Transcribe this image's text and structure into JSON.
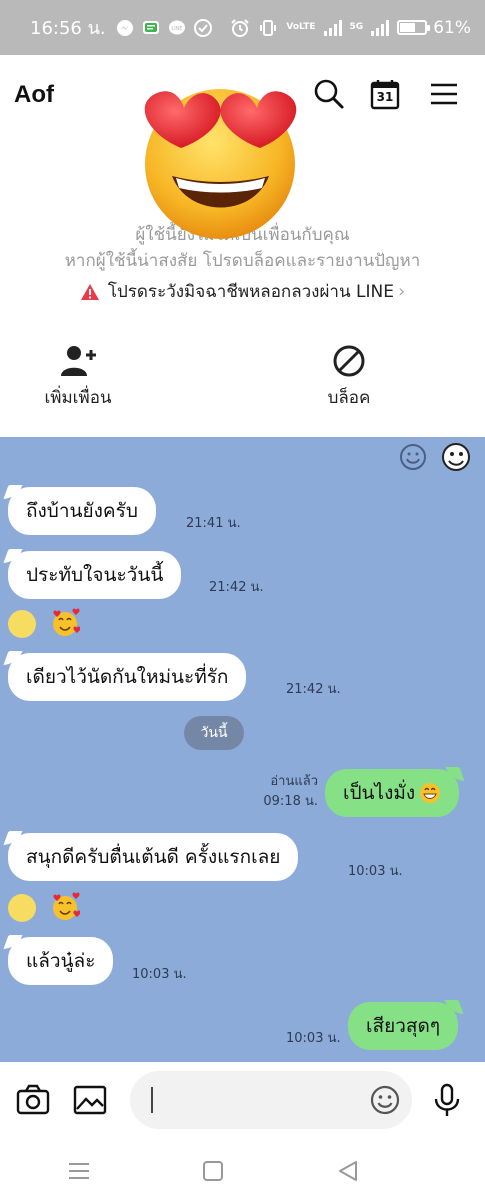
{
  "status_bar": {
    "time": "16:56 น.",
    "network_top": "VoLTE",
    "network_type": "5G",
    "battery": "61%",
    "battery_level": 0.61
  },
  "header": {
    "contact_name": "Aof",
    "calendar_day": "31"
  },
  "notice": {
    "line1": "ผู้ใช้นี้ยังไม่ได้เป็นเพื่อนกับคุณ",
    "line2": "หากผู้ใช้นี้น่าสงสัย โปรดบล็อคและรายงานปัญหา",
    "warning_link": "โปรดระวังมิจฉาชีพหลอกลวงผ่าน LINE"
  },
  "actions": {
    "add_friend": "เพิ่มเพื่อน",
    "block": "บล็อค"
  },
  "chat": {
    "date_divider": "วันนี้",
    "messages": [
      {
        "side": "left",
        "text": "ถึงบ้านยังครับ",
        "time": "21:41 น."
      },
      {
        "side": "left",
        "text": "ประทับใจนะวันนี้",
        "time": "21:42 น."
      },
      {
        "side": "left",
        "text": "เดียวไว้นัดกันใหม่นะที่รัก",
        "time": "21:42 น."
      },
      {
        "side": "right",
        "text": "เป็นไงมั่ง",
        "status": "อ่านแล้ว",
        "time": "09:18 น."
      },
      {
        "side": "left",
        "text": "สนุกดีครับตื่นเต้นดี ครั้งแรกเลย",
        "time": "10:03 น."
      },
      {
        "side": "left",
        "text": "แล้วนู๋ล่ะ",
        "time": "10:03 น."
      },
      {
        "side": "right",
        "text": "เสียวสุดๆ",
        "time": "10:03 น."
      }
    ]
  },
  "input": {
    "value": "",
    "placeholder": ""
  },
  "colors": {
    "chat_background": "#8cabd9",
    "incoming_bubble": "#ffffff",
    "outgoing_bubble": "#85e086",
    "status_bar": "#b9b9b9",
    "warning_red": "#e83a4a"
  }
}
